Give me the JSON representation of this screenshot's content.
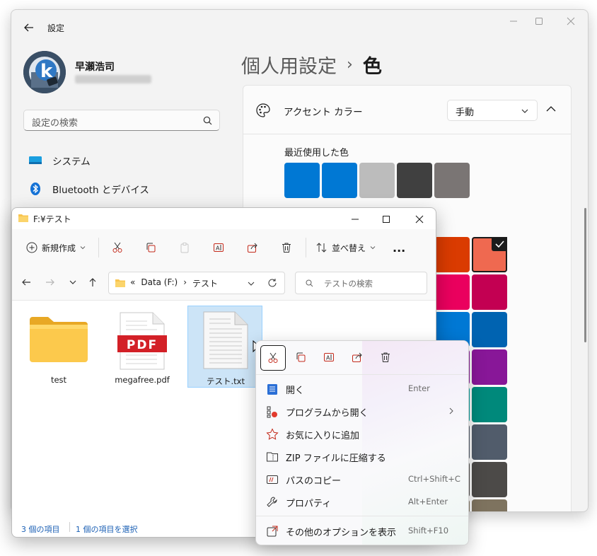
{
  "settings": {
    "title": "設定",
    "user_name": "早瀬浩司",
    "search_placeholder": "設定の検索",
    "nav": [
      {
        "label": "システム"
      },
      {
        "label": "Bluetooth とデバイス"
      }
    ],
    "breadcrumb_parent": "個人用設定",
    "breadcrumb_sep": "›",
    "breadcrumb_current": "色",
    "accent_label": "アクセント カラー",
    "accent_mode": "手動",
    "recent_label": "最近使用した色",
    "recent_colors": [
      "#0078d4",
      "#0078d4",
      "#bcbcbc",
      "#404040",
      "#7a7574"
    ],
    "palette_colors": [
      [
        "#da3b01",
        "#ef6950"
      ],
      [
        "#ea005e",
        "#c30052"
      ],
      [
        "#0078d4",
        "#0063b1"
      ],
      [
        "#881798",
        "#881798"
      ],
      [
        "#00a0a0",
        "#00897b"
      ],
      [
        "#515c6b",
        "#515c6b"
      ],
      [
        "#4c4a48",
        "#4c4a48"
      ],
      [
        "#7e735f",
        "#7e735f"
      ]
    ],
    "selected_color": "#ef6950"
  },
  "explorer": {
    "title": "F:¥テスト",
    "toolbar": {
      "new_label": "新規作成",
      "sort_label": "並べ替え",
      "more_label": "..."
    },
    "address": {
      "prefix": "«",
      "drive": "Data (F:)",
      "sep": "›",
      "folder": "テスト"
    },
    "search_placeholder": "テストの検索",
    "files": [
      {
        "name": "test",
        "type": "folder"
      },
      {
        "name": "megafree.pdf",
        "type": "pdf",
        "badge": "PDF"
      },
      {
        "name": "テスト.txt",
        "type": "text",
        "selected": true
      }
    ],
    "status_count": "3 個の項目",
    "status_selected": "1 個の項目を選択"
  },
  "context_menu": {
    "items": [
      {
        "label": "開く",
        "shortcut": "Enter",
        "icon": "notepad-icon"
      },
      {
        "label": "プログラムから開く",
        "shortcut": "",
        "icon": "open-with-icon",
        "submenu": true
      },
      {
        "label": "お気に入りに追加",
        "shortcut": "",
        "icon": "star-icon"
      },
      {
        "label": "ZIP ファイルに圧縮する",
        "shortcut": "",
        "icon": "zip-folder-icon"
      },
      {
        "label": "パスのコピー",
        "shortcut": "Ctrl+Shift+C",
        "icon": "copy-path-icon"
      },
      {
        "label": "プロパティ",
        "shortcut": "Alt+Enter",
        "icon": "wrench-icon"
      }
    ],
    "more_options": {
      "label": "その他のオプションを表示",
      "shortcut": "Shift+F10",
      "icon": "more-options-icon"
    }
  },
  "colors": {
    "accent": "#0078d4",
    "selection": "#cce4f7",
    "folder_yellow": "#f8c44e",
    "pdf_red": "#d32027"
  }
}
